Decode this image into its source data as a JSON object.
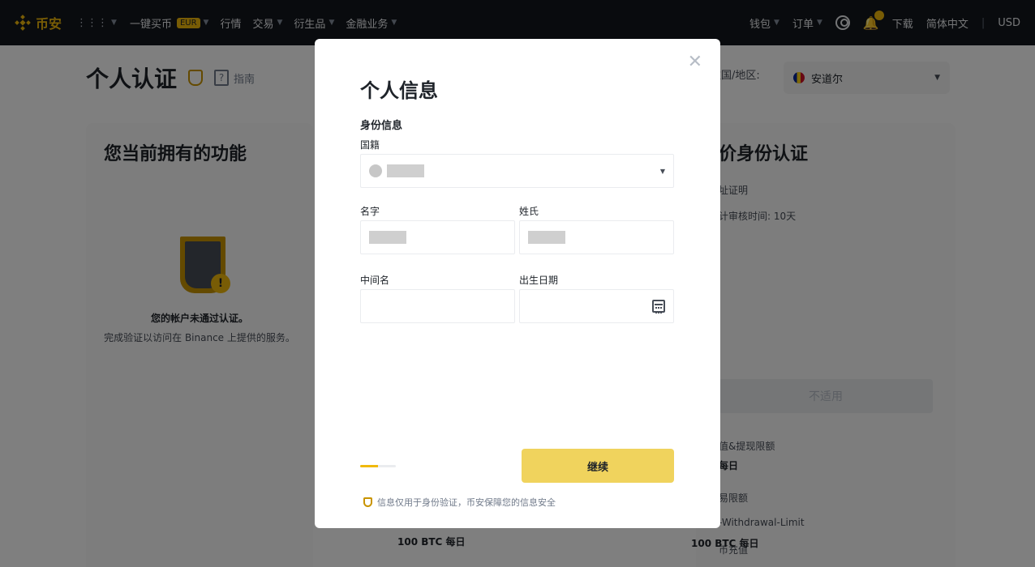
{
  "navbar": {
    "brand": "币安",
    "items": [
      {
        "label": "一键买币",
        "badge": "EUR",
        "caret": true
      },
      {
        "label": "行情",
        "caret": false
      },
      {
        "label": "交易",
        "caret": true
      },
      {
        "label": "衍生品",
        "caret": true
      },
      {
        "label": "金融业务",
        "caret": true
      }
    ],
    "right": {
      "wallet": "钱包",
      "orders": "订单",
      "download": "下载",
      "language": "简体中文",
      "currency": "USD"
    }
  },
  "page": {
    "title": "个人认证",
    "guide": "指南",
    "residence_label": "住国/地区:",
    "residence_value": "安道尔",
    "left_card": {
      "heading": "您当前拥有的功能",
      "status": "您的帐户未通过认证。",
      "desc": "完成验证以访问在 Binance 上提供的服务。",
      "limit_value": "100 BTC 每日"
    },
    "right_card": {
      "heading": "价身份认证",
      "line1": "址证明",
      "line2": "计审核时间: 10天",
      "na_button": "不适用",
      "limit1_label": "值&提现限额",
      "limit1_value": "每日",
      "limit2_label": "易限额",
      "limit3_label": "币充值",
      "limit4_label": "-Withdrawal-Limit",
      "limit4_value": "100 BTC 每日"
    }
  },
  "modal": {
    "title": "个人信息",
    "section": "身份信息",
    "nationality_label": "国籍",
    "first_name_label": "名字",
    "last_name_label": "姓氏",
    "middle_name_label": "中间名",
    "dob_label": "出生日期",
    "progress": 0.5,
    "continue": "继续",
    "note": "信息仅用于身份验证，币安保障您的信息安全"
  }
}
